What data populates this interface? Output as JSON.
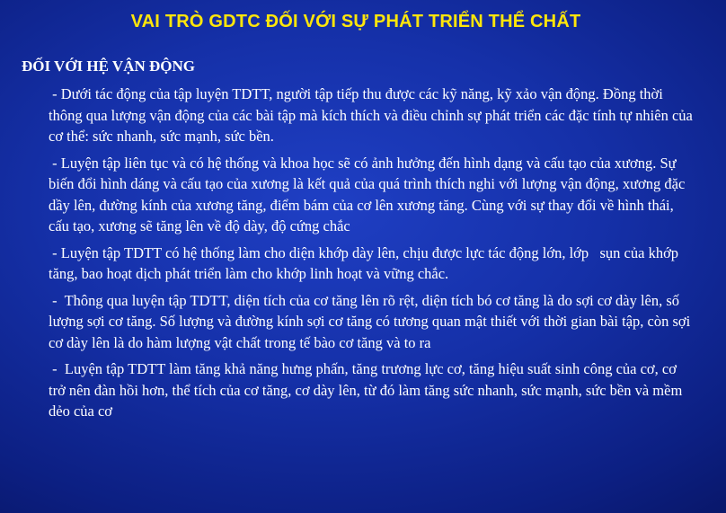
{
  "slide": {
    "title": "VAI TRÒ GDTC ĐỐI VỚI SỰ PHÁT TRIỂN THỂ CHẤT",
    "section_heading": "ĐỐI VỚI HỆ VẬN ĐỘNG",
    "paragraphs": [
      " - Dưới tác động của tập luyện TDTT, người tập tiếp thu được các kỹ năng, kỹ xảo vận động. Đồng thời thông qua lượng vận động của các bài tập mà kích thích và điều chỉnh sự phát triển các đặc tính tự nhiên của cơ thể: sức nhanh, sức mạnh, sức bền.",
      " - Luyện tập liên tục và có hệ thống và khoa học sẽ có ảnh hưởng đến hình dạng và cấu tạo của xương. Sự biến đổi hình dáng và cấu tạo của xương là kết quả của quá trình thích nghi với lượng vận động, xương đặc dầy lên, đường kính của xương tăng, điểm bám của cơ lên xương tăng. Cùng với sự thay đổi về hình thái, cấu tạo, xương sẽ tăng lên về độ dày, độ cứng chắc",
      " - Luyện tập TDTT có hệ thống làm cho diện khớp dày lên, chịu được lực tác động lớn, lớp   sụn của khớp tăng, bao hoạt dịch phát triển làm cho khớp linh hoạt và vững chắc.",
      " -  Thông qua luyện tập TDTT, diện tích của cơ tăng lên rõ rệt, diện tích bó cơ tăng là do sợi cơ dày lên, số lượng sợi cơ tăng. Số lượng và đường kính sợi cơ tăng có tương quan mật thiết với thời gian bài tập, còn sợi cơ dày lên là do hàm lượng vật chất trong tế bào cơ tăng và to ra",
      " -  Luyện tập TDTT làm tăng khả năng hưng phấn, tăng trương lực cơ, tăng hiệu suất sinh công của cơ, cơ trở nên đàn hồi hơn, thể tích của cơ tăng, cơ dày lên, từ đó làm tăng sức nhanh, sức mạnh, sức bền và mềm dẻo của cơ"
    ]
  },
  "colors": {
    "background": "#1530a8",
    "title": "#ffe60a",
    "text": "#ffffff"
  }
}
